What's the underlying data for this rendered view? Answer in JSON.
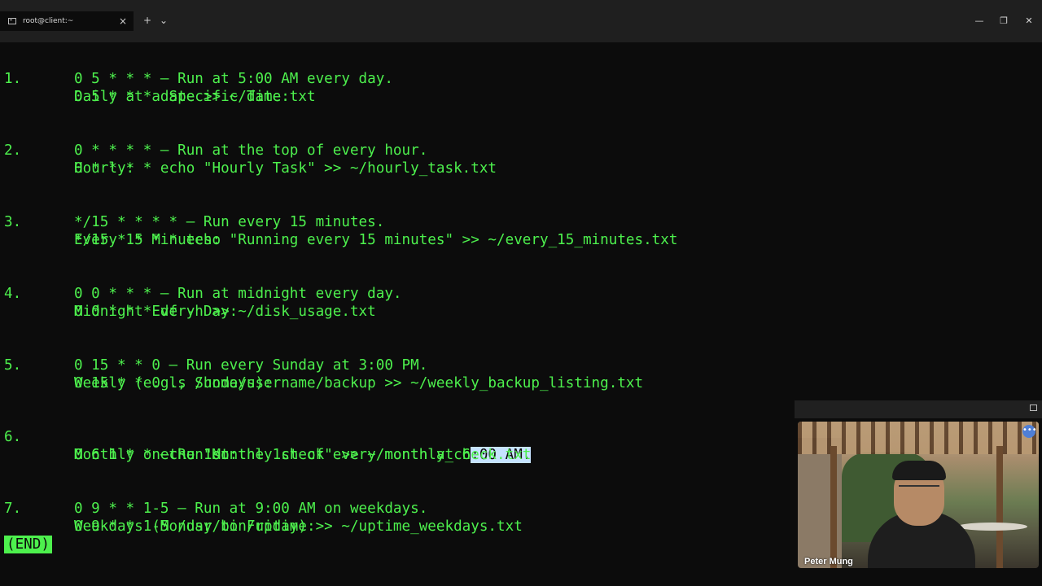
{
  "window": {
    "tab_title": "root@client:~",
    "tab_close": "×",
    "new_tab": "+",
    "tab_dropdown": "⌄",
    "minimize": "—",
    "restore": "❐",
    "close": "✕"
  },
  "terminal": {
    "sections": [
      {
        "num": "1.",
        "heading": "Daily at a Specific Time:",
        "line1": "0 5 * * * – Run at 5:00 AM every day.",
        "line2": "0 5 * * * date >> ~/date.txt"
      },
      {
        "num": "2.",
        "heading": "Hourly:",
        "line1": "0 * * * * – Run at the top of every hour.",
        "line2": "0 * * * * echo \"Hourly Task\" >> ~/hourly_task.txt"
      },
      {
        "num": "3.",
        "heading": "Every 15 Minutes:",
        "line1": "*/15 * * * * – Run every 15 minutes.",
        "line2": "*/15 * * * * echo \"Running every 15 minutes\" >> ~/every_15_minutes.txt"
      },
      {
        "num": "4.",
        "heading": "Midnight Every Day:",
        "line1": "0 0 * * * – Run at midnight every day.",
        "line2": "0 0 * * * df -h >> ~/disk_usage.txt"
      },
      {
        "num": "5.",
        "heading": "Weekly (e.g., Sundays):",
        "line1": "0 15 * * 0 – Run every Sunday at 3:00 PM.",
        "line2": "0 15 * * 0 ls /home/username/backup >> ~/weekly_backup_listing.txt"
      },
      {
        "num": "6.",
        "heading": "Monthly on the 1st:",
        "line1_before": "0 6 1 * * – Run on the 1st of every month at 6",
        "line1_selected": ":00 AM.",
        "line2": "0 6 1 * * echo \"Monthly check\" >> ~/monthly_check.txt"
      },
      {
        "num": "7.",
        "heading": "Weekdays (Monday to Friday):",
        "line1": "0 9 * * 1-5 – Run at 9:00 AM on weekdays.",
        "line2": "0 9 * * 1-5 /usr/bin/uptime >> ~/uptime_weekdays.txt"
      }
    ],
    "pager_status": "(END)"
  },
  "video_overlay": {
    "participant_name": "Peter Mung",
    "more_label": "•••"
  },
  "colors": {
    "terminal_text": "#4df04d",
    "terminal_bg": "#0c0c0c",
    "selection": "#c6e3ff"
  }
}
